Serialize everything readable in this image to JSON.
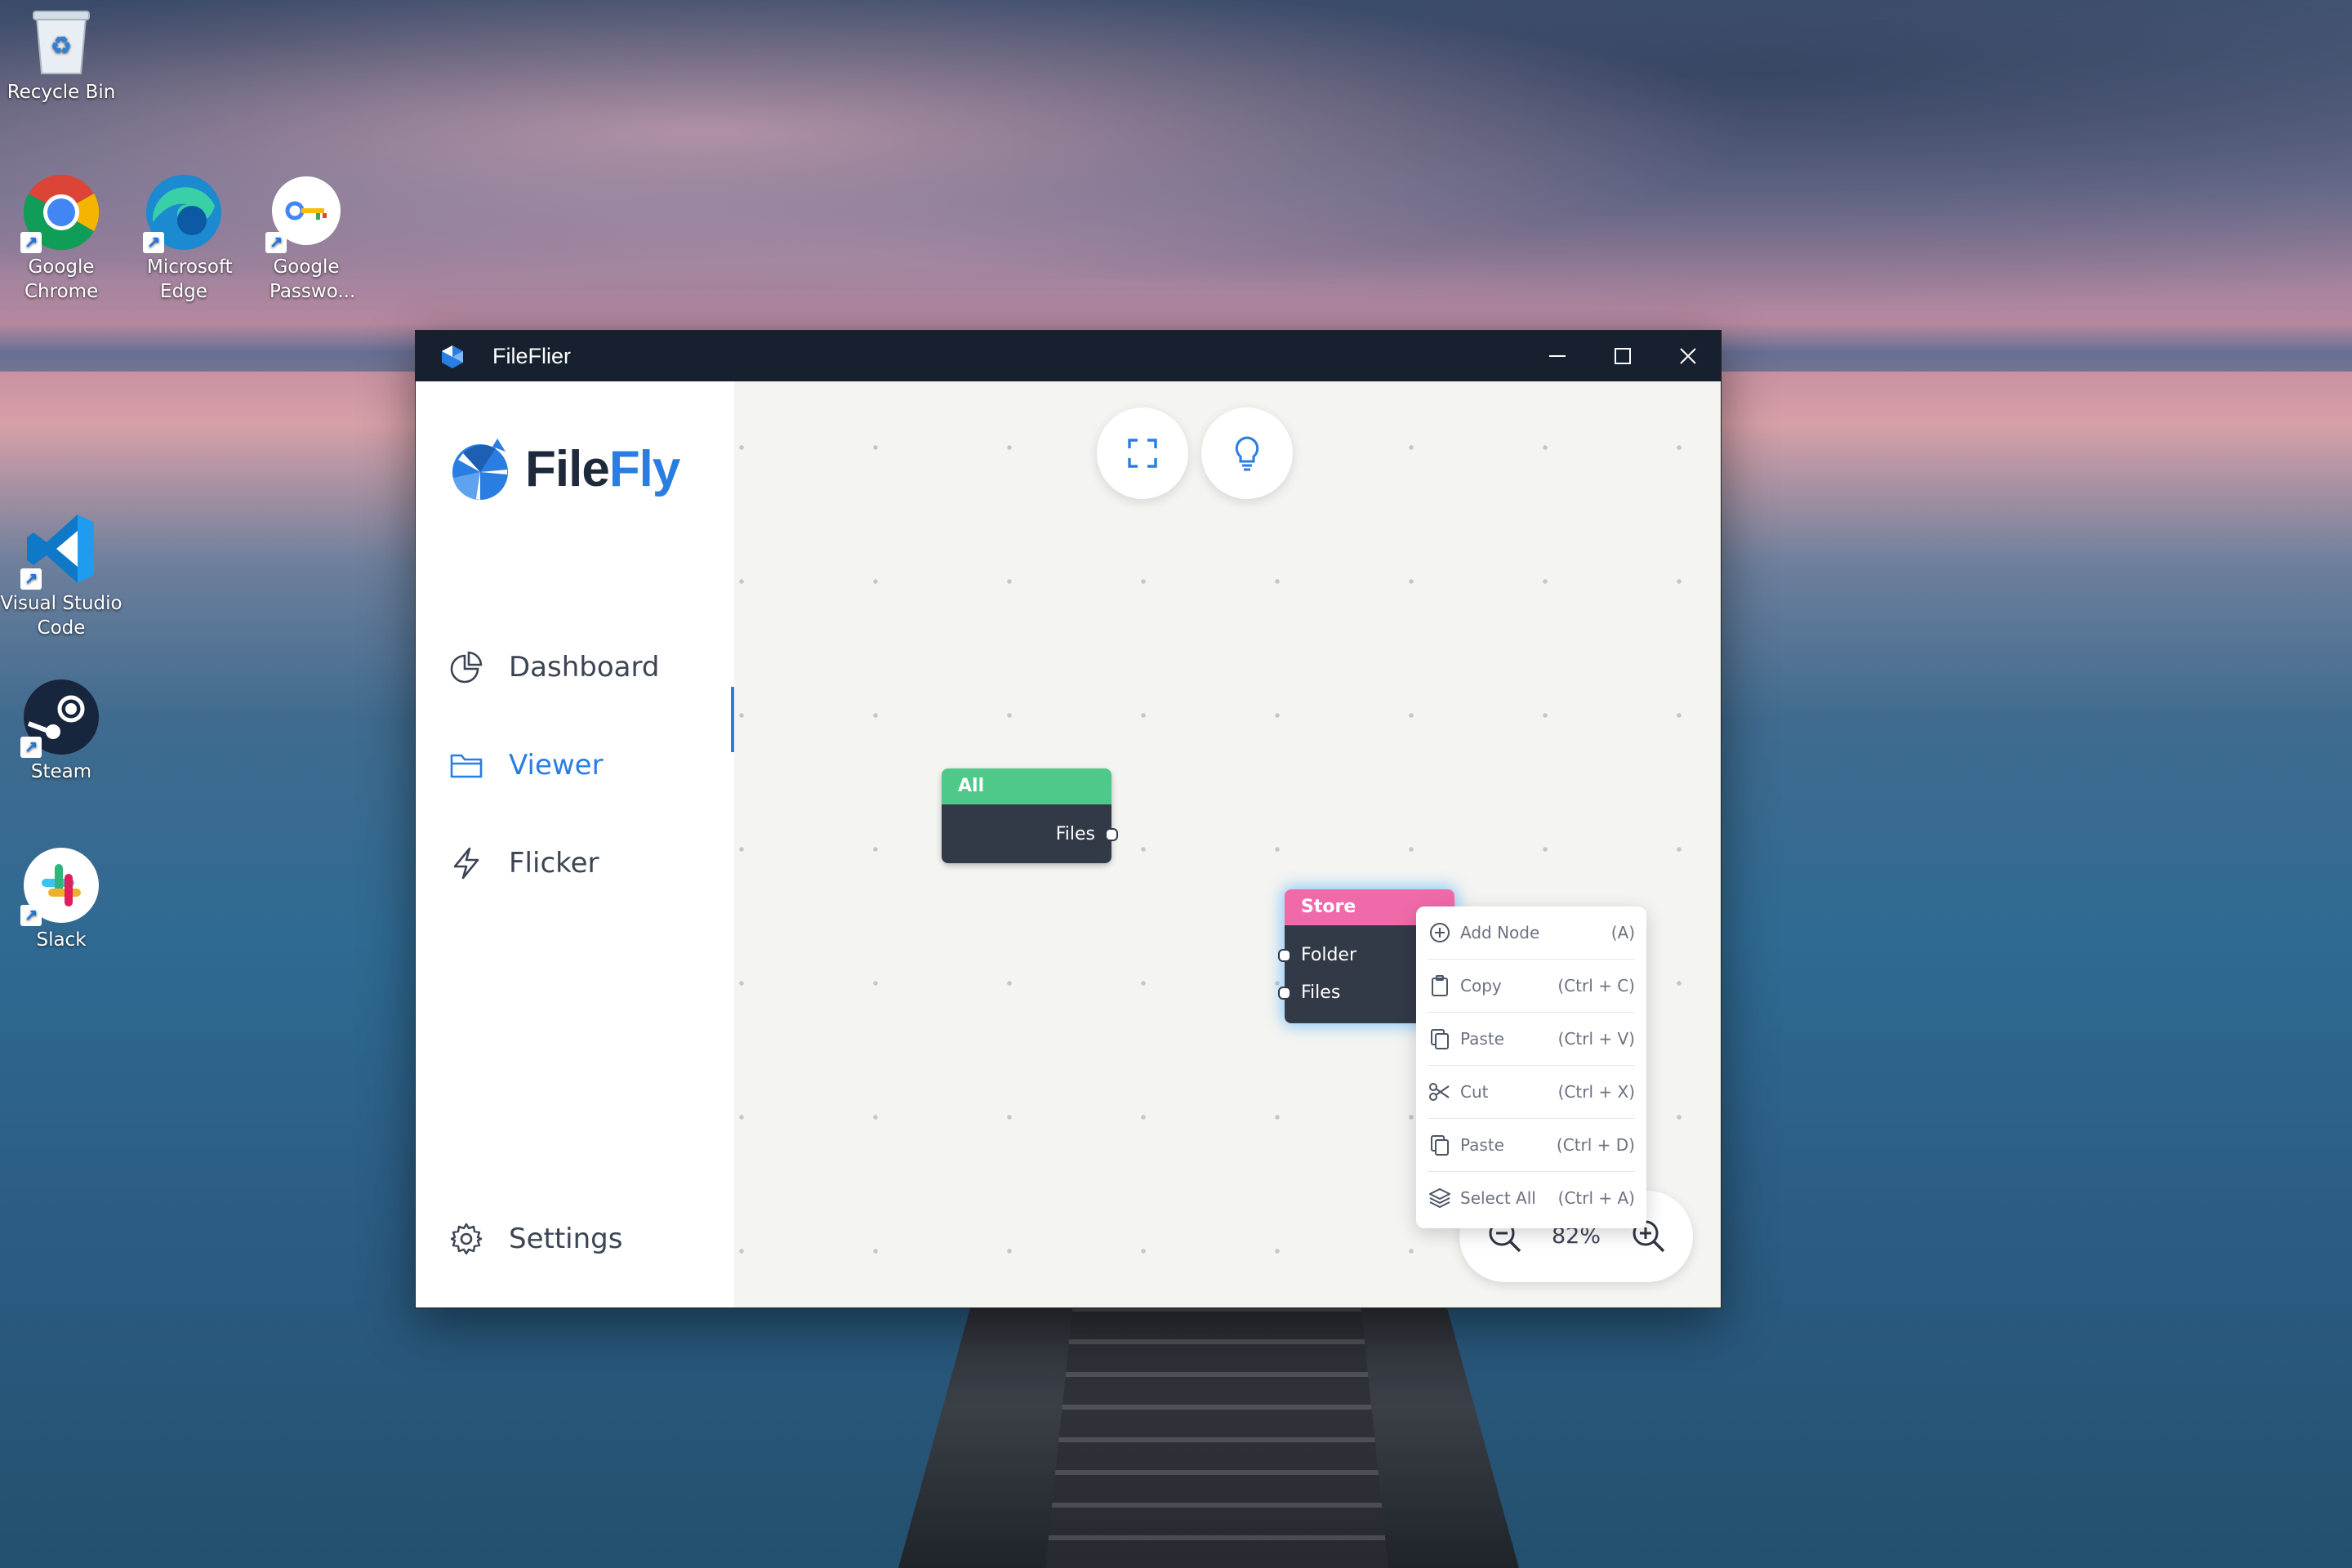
{
  "desktop": {
    "icons": [
      {
        "label": "Recycle Bin",
        "icon": "recycle-bin-icon"
      },
      {
        "label": "Google Chrome",
        "icon": "chrome-icon"
      },
      {
        "label": "Microsoft Edge",
        "icon": "edge-icon"
      },
      {
        "label": "Google Passwo...",
        "icon": "google-password-icon"
      },
      {
        "label": "Visual Studio Code",
        "icon": "vscode-icon"
      },
      {
        "label": "Steam",
        "icon": "steam-icon"
      },
      {
        "label": "Slack",
        "icon": "slack-icon"
      }
    ]
  },
  "window": {
    "title": "FileFlier",
    "controls": [
      "minimize-icon",
      "maximize-icon",
      "close-icon"
    ]
  },
  "sidebar": {
    "logo": {
      "part1": "File",
      "part2": "Fly"
    },
    "items": [
      {
        "label": "Dashboard",
        "icon": "pie-chart-icon"
      },
      {
        "label": "Viewer",
        "icon": "folder-icon",
        "active": true
      },
      {
        "label": "Flicker",
        "icon": "lightning-icon"
      },
      {
        "label": "Settings",
        "icon": "gear-icon"
      }
    ]
  },
  "canvas": {
    "buttons": [
      "fullscreen-icon",
      "lightbulb-icon"
    ],
    "nodes": [
      {
        "title": "All",
        "color": "#4fc98a",
        "outputs": [
          "Files"
        ]
      },
      {
        "title": "Store",
        "color": "#f06aaa",
        "inputs": [
          "Folder",
          "Files"
        ]
      }
    ],
    "zoom": {
      "value": "82%"
    }
  },
  "context_menu": {
    "items": [
      {
        "label": "Add Node",
        "shortcut": "(A)",
        "icon": "plus-circle-icon"
      },
      {
        "label": "Copy",
        "shortcut": "(Ctrl + C)",
        "icon": "clipboard-icon"
      },
      {
        "label": "Paste",
        "shortcut": "(Ctrl + V)",
        "icon": "paste-icon"
      },
      {
        "label": "Cut",
        "shortcut": "(Ctrl + X)",
        "icon": "scissors-icon"
      },
      {
        "label": "Paste",
        "shortcut": "(Ctrl + D)",
        "icon": "paste-icon"
      },
      {
        "label": "Select All",
        "shortcut": "(Ctrl + A)",
        "icon": "layers-icon"
      }
    ]
  },
  "colors": {
    "accent": "#2a7de1",
    "titlebar": "#16202f",
    "node_body": "#323a47"
  }
}
